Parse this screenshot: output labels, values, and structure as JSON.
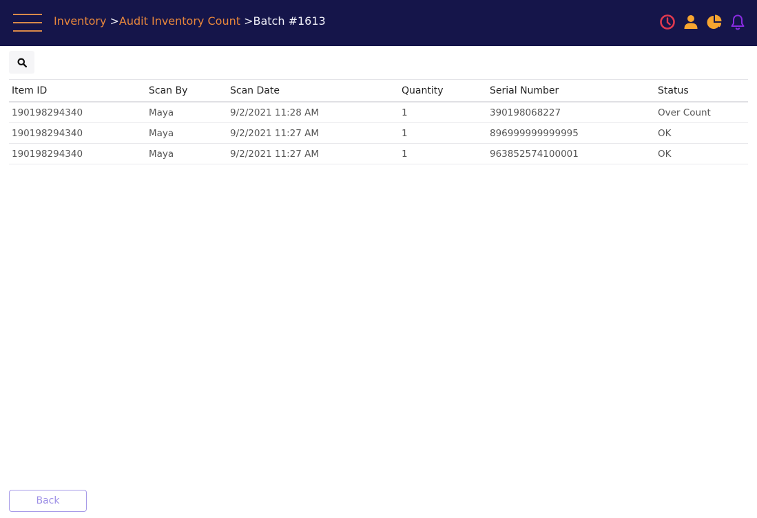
{
  "header": {
    "breadcrumb": [
      {
        "label": "Inventory",
        "link": true
      },
      {
        "label": "Audit Inventory Count",
        "link": true
      },
      {
        "label": "Batch #1613",
        "link": false
      }
    ],
    "separator": ">",
    "icons": [
      {
        "name": "clock-icon",
        "color": "#e0394f"
      },
      {
        "name": "user-icon",
        "color": "#f7a530"
      },
      {
        "name": "pie-chart-icon",
        "color": "#f7a530"
      },
      {
        "name": "bell-icon",
        "color": "#8a2be2"
      }
    ]
  },
  "search": {
    "icon": "search-icon"
  },
  "table": {
    "columns": [
      "Item ID",
      "Scan By",
      "Scan Date",
      "Quantity",
      "Serial Number",
      "Status"
    ],
    "rows": [
      [
        "190198294340",
        "Maya",
        "9/2/2021 11:28 AM",
        "1",
        "390198068227",
        "Over Count"
      ],
      [
        "190198294340",
        "Maya",
        "9/2/2021 11:27 AM",
        "1",
        "896999999999995",
        "OK"
      ],
      [
        "190198294340",
        "Maya",
        "9/2/2021 11:27 AM",
        "1",
        "963852574100001",
        "OK"
      ]
    ]
  },
  "footer": {
    "back_label": "Back"
  }
}
